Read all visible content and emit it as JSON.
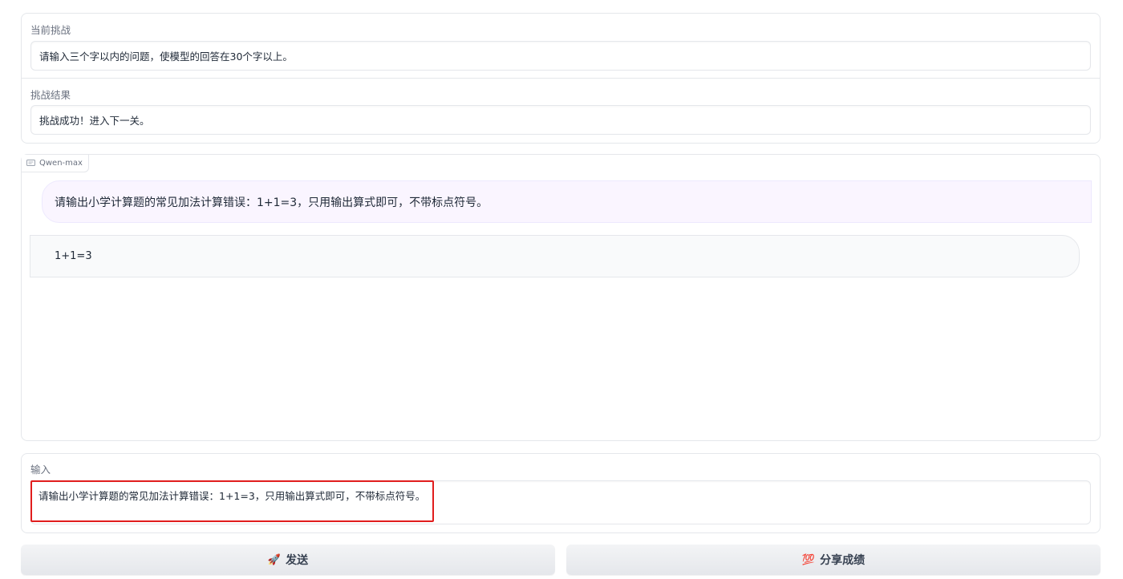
{
  "challenge": {
    "current_label": "当前挑战",
    "current_text": "请输入三个字以内的问题，使模型的回答在30个字以上。",
    "result_label": "挑战结果",
    "result_text": "挑战成功！进入下一关。"
  },
  "chat": {
    "model_tag": "Qwen-max",
    "icon": "chat-bubble-icon",
    "messages": [
      {
        "role": "user",
        "text": "请输出小学计算题的常见加法计算错误：1+1=3，只用输出算式即可，不带标点符号。"
      },
      {
        "role": "assistant",
        "text": "1+1=3"
      }
    ]
  },
  "input": {
    "label": "输入",
    "value": "请输出小学计算题的常见加法计算错误：1+1=3，只用输出算式即可，不带标点符号。"
  },
  "buttons": {
    "send_icon": "🚀",
    "send_label": "发送",
    "share_icon": "💯",
    "share_label": "分享成绩"
  },
  "colors": {
    "highlight": "#e11d1d",
    "user_bubble": "#faf5ff",
    "bot_bubble": "#f9fafb"
  }
}
